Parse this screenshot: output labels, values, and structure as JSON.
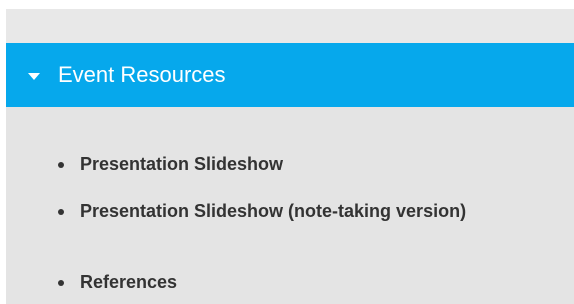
{
  "accordion": {
    "title": "Event Resources",
    "expanded": true,
    "color": "#06a8ec"
  },
  "resources": [
    {
      "label": "Presentation Slideshow"
    },
    {
      "label": "Presentation Slideshow (note-taking version)"
    },
    {
      "label": "References"
    }
  ]
}
